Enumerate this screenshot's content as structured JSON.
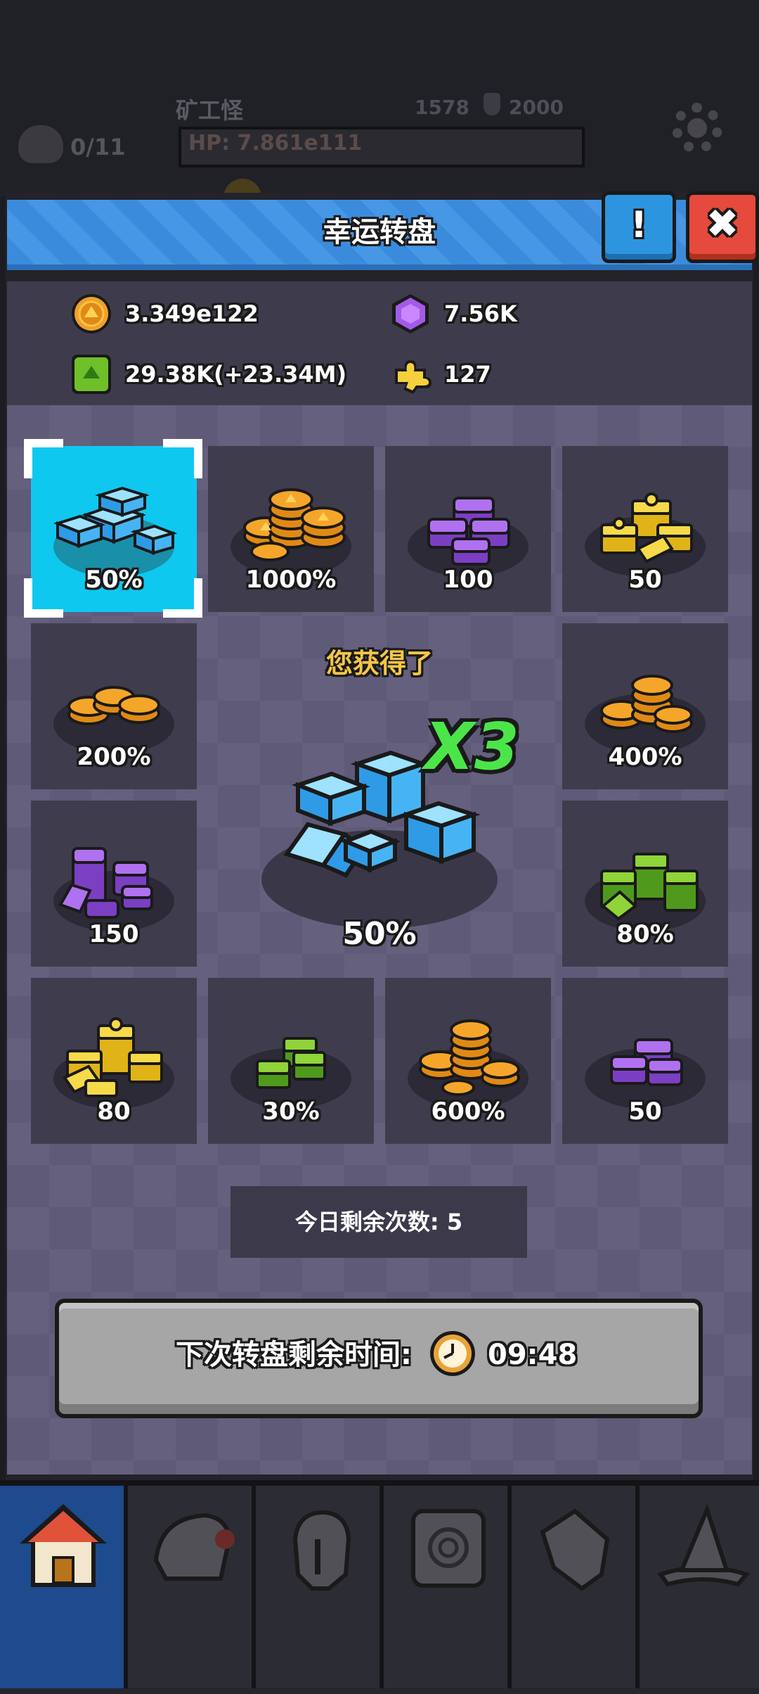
{
  "background": {
    "monster_name": "矿工怪",
    "kill_count": "0/11",
    "level": "1578",
    "max_level": "2000",
    "hp_text": "HP: 7.861e111"
  },
  "dialog": {
    "title": "幸运转盘",
    "info_label": "!",
    "close_label": "✖"
  },
  "resources": {
    "gold": "3.349e122",
    "gems": "7.56K",
    "green": "29.38K(+23.34M)",
    "puzzle": "127"
  },
  "wheel": {
    "cells": [
      {
        "icon": "blue-gem-stack-icon",
        "label": "50%",
        "selected": true
      },
      {
        "icon": "gold-coin-stack-icon",
        "label": "1000%"
      },
      {
        "icon": "purple-gem-stack-icon",
        "label": "100"
      },
      {
        "icon": "yellow-puzzle-stack-icon",
        "label": "50"
      },
      {
        "icon": "gold-coin-stack-icon",
        "label": "400%"
      },
      {
        "icon": "green-cube-stack-icon",
        "label": "80%"
      },
      {
        "icon": "purple-gem-stack-icon",
        "label": "50"
      },
      {
        "icon": "gold-coin-stack-icon",
        "label": "600%"
      },
      {
        "icon": "green-cube-stack-icon",
        "label": "30%"
      },
      {
        "icon": "yellow-puzzle-stack-icon",
        "label": "80"
      },
      {
        "icon": "purple-gem-stack-icon",
        "label": "150"
      },
      {
        "icon": "gold-coin-stack-icon",
        "label": "200%"
      }
    ]
  },
  "reward": {
    "title": "您获得了",
    "multiplier": "X3",
    "amount": "50%",
    "icon": "blue-gem-stack-icon"
  },
  "remaining": {
    "label": "今日剩余次数: 5"
  },
  "timer": {
    "label": "下次转盘剩余时间:",
    "value": "09:48"
  },
  "nav": {
    "tabs": [
      "home-icon",
      "shoulder-armor-icon",
      "helmet-icon",
      "scroll-icon",
      "gauntlet-icon",
      "wizard-hat-icon"
    ]
  }
}
